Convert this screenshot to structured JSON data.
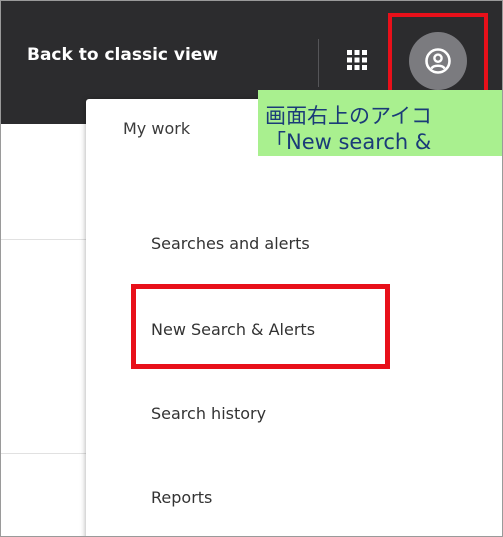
{
  "header": {
    "back_to_classic_label": "Back to classic view",
    "apps_icon": "grid-apps-icon",
    "user_icon": "user-circle-icon"
  },
  "menu": {
    "section_label": "My work",
    "items": [
      {
        "label": "Searches and alerts"
      },
      {
        "label": "New Search & Alerts"
      },
      {
        "label": "Search history"
      },
      {
        "label": "Reports"
      }
    ]
  },
  "annotation": {
    "line1": "画面右上のアイコ",
    "line2": "「New search &"
  },
  "colors": {
    "topbar": "#2c2c2e",
    "highlight": "#e8101a",
    "callout_bg": "#a9f08f",
    "callout_text": "#1a3b78"
  }
}
